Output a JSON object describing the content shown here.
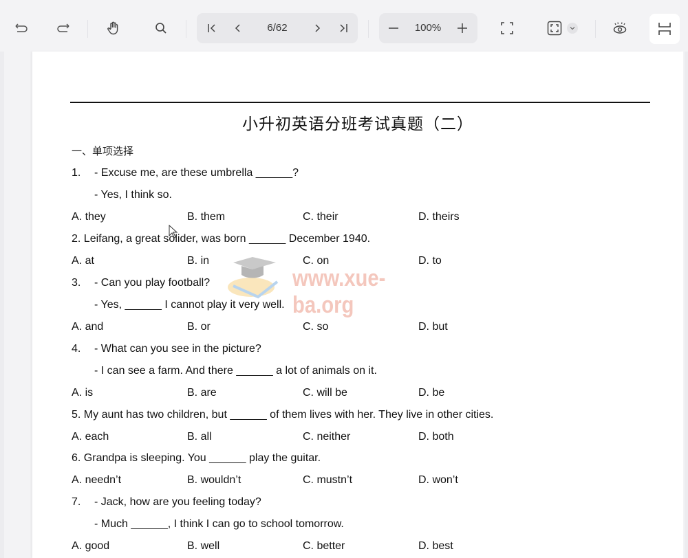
{
  "toolbar": {
    "undo": "undo",
    "redo": "redo",
    "hand_tool": "hand",
    "search": "search",
    "first_page": "first-page",
    "prev_page": "previous-page",
    "page_indicator": "6/62",
    "next_page": "next-page",
    "last_page": "last-page",
    "zoom_out": "zoom-out",
    "zoom_level": "100%",
    "zoom_in": "zoom-in",
    "fullscreen": "fullscreen",
    "fit_page": "fit-page",
    "eye_care": "eye-care-mode",
    "layout": "page-layout"
  },
  "document": {
    "title": "小升初英语分班考试真题（二）",
    "section": "一、单项选择",
    "watermark": "www.xue-ba.org",
    "questions": [
      {
        "lines": [
          "1.",
          "- Excuse me, are these umbrella ______?",
          "- Yes, I think so."
        ],
        "options": [
          "A. they",
          "B. them",
          "C. their",
          "D. theirs"
        ]
      },
      {
        "lines": [
          "2. Leifang, a great solider, was born ______ December 1940."
        ],
        "options": [
          "A. at",
          "B. in",
          "C. on",
          "D. to"
        ]
      },
      {
        "lines": [
          "3.",
          "- Can you play football?",
          "- Yes, ______ I cannot play it very well."
        ],
        "options": [
          "A. and",
          "B. or",
          "C. so",
          "D. but"
        ]
      },
      {
        "lines": [
          "4.",
          "- What can you see in the picture?",
          "- I can see a farm. And there ______ a lot of animals on it."
        ],
        "options": [
          "A. is",
          "B. are",
          "C. will be",
          "D. be"
        ]
      },
      {
        "lines": [
          "5. My aunt has two children, but ______ of them lives with her. They live in other cities."
        ],
        "options": [
          "A. each",
          "B. all",
          "C. neither",
          "D. both"
        ]
      },
      {
        "lines": [
          "6. Grandpa is sleeping. You ______ play the guitar."
        ],
        "options": [
          "A. needn’t",
          "B. wouldn’t",
          "C. mustn’t",
          "D. won’t"
        ]
      },
      {
        "lines": [
          "7.",
          "- Jack, how are you feeling today?",
          "- Much ______, I think I can go to school tomorrow."
        ],
        "options": [
          "A. good",
          "B. well",
          "C. better",
          "D. best"
        ]
      }
    ]
  }
}
